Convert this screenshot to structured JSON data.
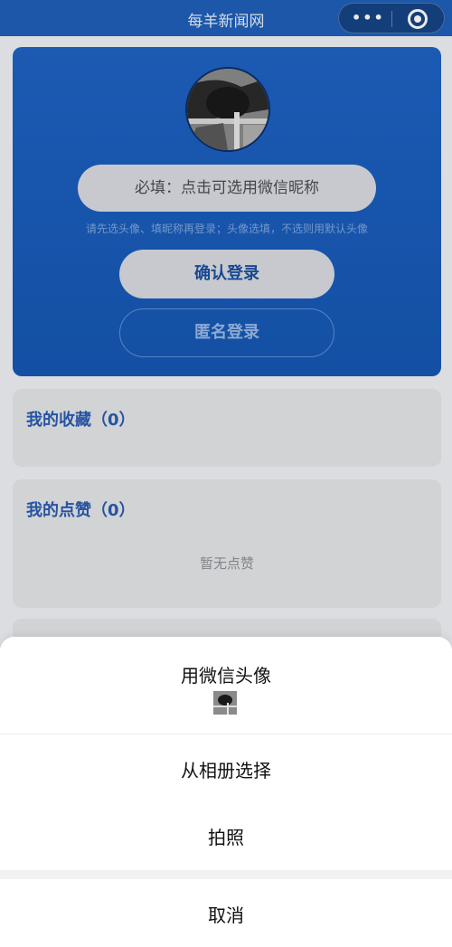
{
  "navbar": {
    "title": "每羊新闻网"
  },
  "login": {
    "nickname_placeholder": "必填：点击可选用微信昵称",
    "hint": "请先选头像、填昵称再登录；头像选填，不选则用默认头像",
    "confirm_label": "确认登录",
    "anonymous_label": "匿名登录"
  },
  "favorites": {
    "title": "我的收藏（0）"
  },
  "likes": {
    "title": "我的点赞（0）",
    "empty": "暂无点赞"
  },
  "action_sheet": {
    "wechat_avatar": "用微信头像",
    "album": "从相册选择",
    "photo": "拍照",
    "cancel": "取消"
  },
  "colors": {
    "nav_bg": "#1f5fb8",
    "card_bg": "#1f62c3",
    "accent_text": "#2a5bb0"
  }
}
